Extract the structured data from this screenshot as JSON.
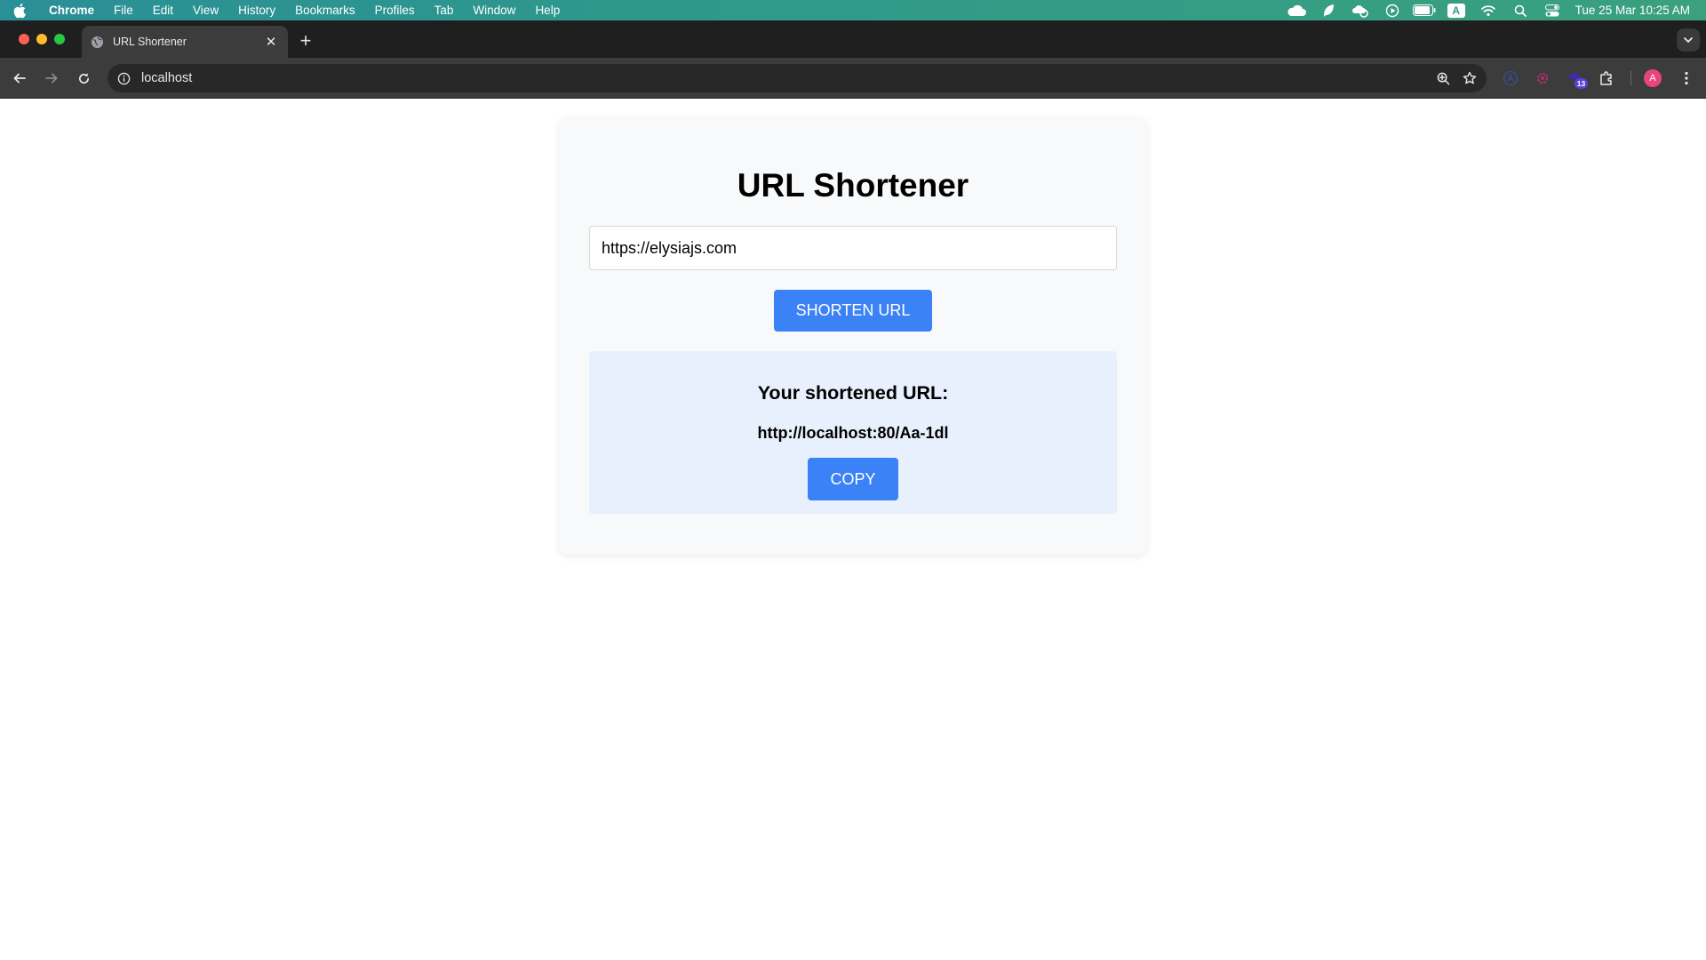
{
  "menubar": {
    "app_name": "Chrome",
    "items": [
      "File",
      "Edit",
      "View",
      "History",
      "Bookmarks",
      "Profiles",
      "Tab",
      "Window",
      "Help"
    ],
    "status_icons": [
      "cloud-icon",
      "leaf-icon",
      "backup-icon",
      "play-icon",
      "battery-icon",
      "input-source-icon",
      "wifi-icon",
      "spotlight-icon",
      "control-center-icon"
    ],
    "input_source_label": "A",
    "clock": "Tue 25 Mar  10:25 AM"
  },
  "browser": {
    "tab_title": "URL Shortener",
    "address": "localhost",
    "extension_badge": "13",
    "profile_initial": "A"
  },
  "page": {
    "title": "URL Shortener",
    "input_value": "https://elysiajs.com",
    "shorten_label": "SHORTEN URL",
    "result_heading": "Your shortened URL:",
    "short_url": "http://localhost:80/Aa-1dl",
    "copy_label": "COPY"
  },
  "colors": {
    "accent": "#3b82f6",
    "result_bg": "#e8f0fd",
    "card_bg": "#f8f9fa"
  }
}
